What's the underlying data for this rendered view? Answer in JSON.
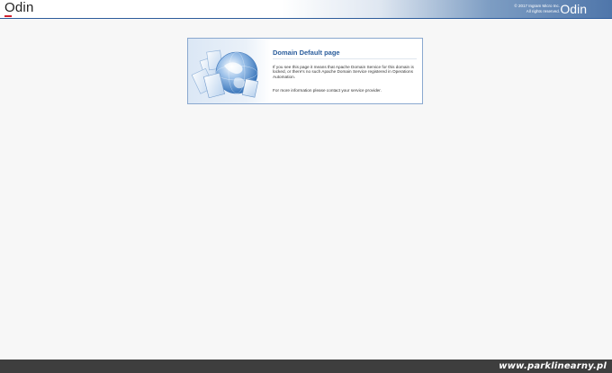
{
  "header": {
    "logo_left": "Odin",
    "copyright_line1": "© 2017 Ingram Micro Inc.",
    "copyright_line2": "All rights reserved.",
    "logo_right": "Odin"
  },
  "content": {
    "illustration_icon": "globe-with-documents-icon",
    "title": "Domain Default page",
    "paragraph1": "If you see this page it means that Apache Domain Service for this domain is locked, or there's no such Apache Domain Service registered in Operations Automation.",
    "paragraph2": "For more information please contact your service provider."
  },
  "footer": {
    "site": "www.parklinearny.pl"
  },
  "colors": {
    "accent": "#2b5d9c",
    "header_gradient_end": "#4f76aa",
    "footer_bg": "#3e3e3e",
    "logo_underline": "#d0232f"
  }
}
